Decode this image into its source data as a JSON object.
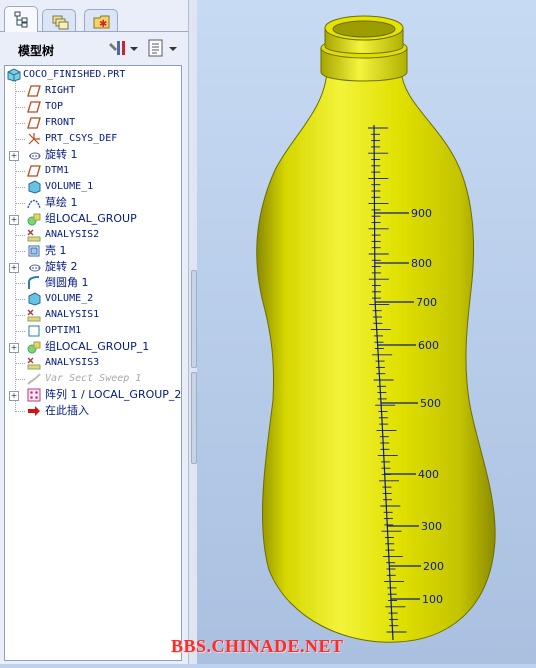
{
  "panel": {
    "title": "模型树",
    "tabs": [
      "model-tree-tab",
      "layers-tab",
      "favorites-tab"
    ]
  },
  "tree": {
    "root": "COCO_FINISHED.PRT",
    "items": [
      {
        "label": "RIGHT",
        "icon": "datum-plane-icon",
        "expandable": false
      },
      {
        "label": "TOP",
        "icon": "datum-plane-icon",
        "expandable": false
      },
      {
        "label": "FRONT",
        "icon": "datum-plane-icon",
        "expandable": false
      },
      {
        "label": "PRT_CSYS_DEF",
        "icon": "csys-icon",
        "expandable": false
      },
      {
        "label": "旋转 1",
        "icon": "revolve-icon",
        "expandable": true
      },
      {
        "label": "DTM1",
        "icon": "datum-plane-icon",
        "expandable": false
      },
      {
        "label": "VOLUME_1",
        "icon": "volume-icon",
        "expandable": false
      },
      {
        "label": "草绘 1",
        "icon": "sketch-icon",
        "expandable": false
      },
      {
        "label": "组LOCAL_GROUP",
        "icon": "group-icon",
        "expandable": true
      },
      {
        "label": "ANALYSIS2",
        "icon": "analysis-icon",
        "expandable": false
      },
      {
        "label": "壳 1",
        "icon": "shell-icon",
        "expandable": false
      },
      {
        "label": "旋转 2",
        "icon": "revolve-icon",
        "expandable": true
      },
      {
        "label": "倒圆角 1",
        "icon": "round-icon",
        "expandable": false
      },
      {
        "label": "VOLUME_2",
        "icon": "volume-icon",
        "expandable": false
      },
      {
        "label": "ANALYSIS1",
        "icon": "analysis-icon",
        "expandable": false
      },
      {
        "label": "OPTIM1",
        "icon": "optim-icon",
        "expandable": false
      },
      {
        "label": "组LOCAL_GROUP_1",
        "icon": "group-icon",
        "expandable": true
      },
      {
        "label": "ANALYSIS3",
        "icon": "analysis-icon",
        "expandable": false
      },
      {
        "label": "Var Sect Sweep 1",
        "icon": "sweep-icon",
        "expandable": false,
        "suppressed": true
      },
      {
        "label": "阵列 1 / LOCAL_GROUP_2",
        "icon": "pattern-icon",
        "expandable": true
      },
      {
        "label": "在此插入",
        "icon": "insert-here-arrow-icon",
        "expandable": false
      }
    ]
  },
  "scale_labels": [
    "900",
    "800",
    "700",
    "600",
    "500",
    "400",
    "300",
    "200",
    "100"
  ],
  "watermark": "BBS.CHINADE.NET",
  "colors": {
    "bottle": "#e6e600",
    "scale": "#0a1a8c",
    "background": "#bcd2ee",
    "watermark": "#ff2a2a"
  }
}
